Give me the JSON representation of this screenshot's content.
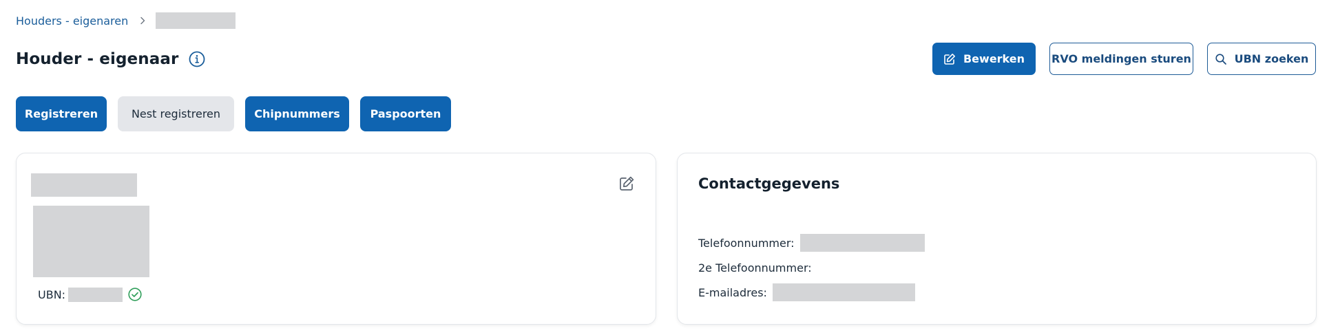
{
  "breadcrumb": {
    "parent_label": "Houders - eigenaren"
  },
  "header": {
    "title": "Houder - eigenaar",
    "buttons": {
      "edit_label": "Bewerken",
      "rvo_label": "RVO meldingen sturen",
      "ubn_search_label": "UBN zoeken"
    }
  },
  "actions": {
    "register_label": "Registreren",
    "nest_register_label": "Nest registreren",
    "chipnumbers_label": "Chipnummers",
    "passports_label": "Paspoorten"
  },
  "owner_card": {
    "ubn_label": "UBN:"
  },
  "contact_card": {
    "title": "Contactgegevens",
    "phone_label": "Telefoonnummer:",
    "phone2_label": "2e Telefoonnummer:",
    "email_label": "E-mailadres:"
  },
  "colors": {
    "primary": "#0f64b1",
    "link": "#1a5d9a",
    "success": "#2f9e5a",
    "redacted": "#d4d5d7"
  },
  "icons": {
    "breadcrumb_separator": "chevron-right-icon",
    "info": "info-icon",
    "edit": "pencil-square-icon",
    "search": "search-icon",
    "verified": "check-circle-icon"
  }
}
